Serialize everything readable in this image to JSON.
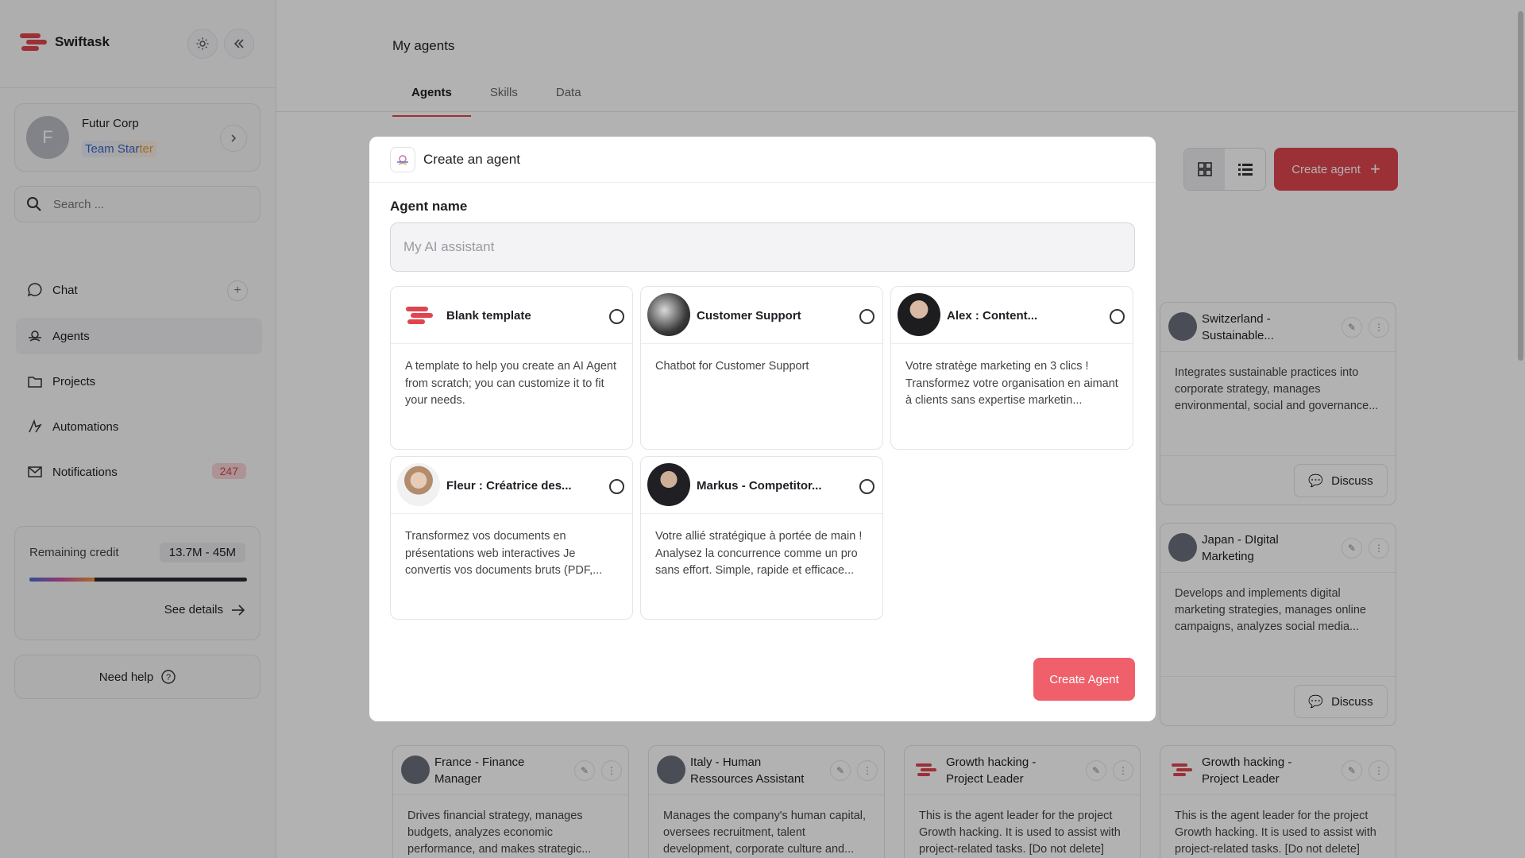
{
  "brand": {
    "name": "Swiftask"
  },
  "org": {
    "avatar_letter": "F",
    "name": "Futur Corp",
    "plan_a": "Team Star",
    "plan_b": "ter"
  },
  "search": {
    "placeholder": "Search ..."
  },
  "nav": {
    "chat": "Chat",
    "agents": "Agents",
    "projects": "Projects",
    "automations": "Automations",
    "notifications": "Notifications",
    "notifications_count": "247"
  },
  "credit": {
    "label": "Remaining credit",
    "value": "13.7M - 45M",
    "fraction_used": 0.3,
    "link": "See details"
  },
  "help": {
    "label": "Need help"
  },
  "main": {
    "title": "My agents",
    "tabs": [
      "Agents",
      "Skills",
      "Data"
    ],
    "create_button": "Create agent"
  },
  "background_agents": [
    {
      "title": "Switzerland - Sustainable...",
      "desc": "Integrates sustainable practices into corporate strategy, manages environmental, social and governance...",
      "action": "Discuss"
    },
    {
      "title": "Japan - DIgital Marketing",
      "desc": "Develops and implements digital marketing strategies, manages online campaigns, analyzes social media...",
      "action": "Discuss"
    },
    {
      "title": "France - Finance Manager",
      "desc": "Drives financial strategy, manages budgets, analyzes economic performance, and makes strategic..."
    },
    {
      "title": "Italy - Human Ressources Assistant",
      "desc": "Manages the company's human capital, oversees recruitment, talent development, corporate culture and..."
    },
    {
      "title": "Growth hacking - Project Leader",
      "desc": "This is the agent leader for the project Growth hacking. It is used to assist with project-related tasks. [Do not delete]"
    },
    {
      "title": "Growth hacking - Project Leader",
      "desc": "This is the agent leader for the project Growth hacking. It is used to assist with project-related tasks. [Do not delete]"
    }
  ],
  "modal": {
    "title": "Create an agent",
    "field_label": "Agent name",
    "input_placeholder": "My AI assistant",
    "submit": "Create Agent",
    "templates": [
      {
        "name": "Blank template",
        "desc": "A template to help you create an AI Agent from scratch; you can customize it to fit your needs."
      },
      {
        "name": "Customer Support",
        "desc": "Chatbot for Customer Support"
      },
      {
        "name": "Alex : Content...",
        "desc": "Votre stratège marketing en 3 clics ! Transformez votre organisation en aimant à clients sans expertise marketin..."
      },
      {
        "name": "Fleur : Créatrice des...",
        "desc": "Transformez vos documents en présentations web interactives Je convertis vos documents bruts (PDF,..."
      },
      {
        "name": "Markus - Competitor...",
        "desc": "Votre allié stratégique à portée de main ! Analysez la concurrence comme un pro sans effort. Simple, rapide et efficace..."
      }
    ]
  },
  "colors": {
    "accent": "#e0454f",
    "button": "#f0606b"
  }
}
